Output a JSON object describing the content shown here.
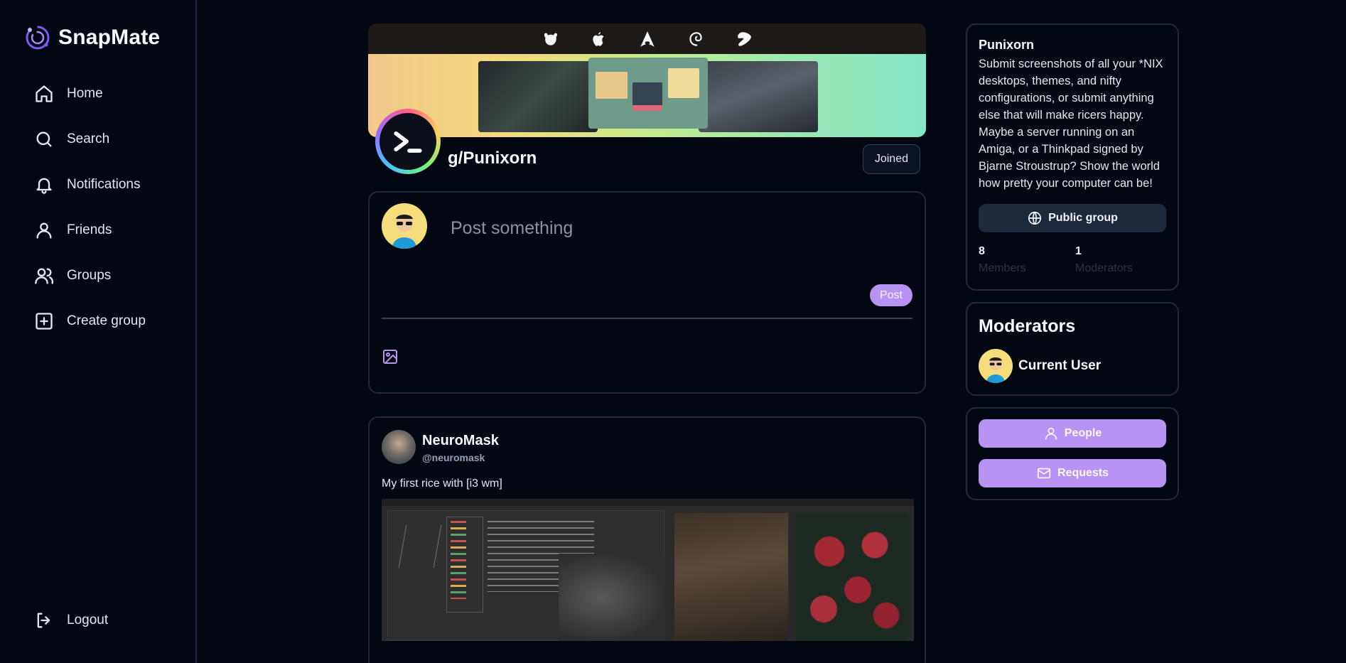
{
  "brand": {
    "name": "SnapMate",
    "accent": "#9b6bff"
  },
  "nav": {
    "items": [
      {
        "label": "Home",
        "icon": "home-icon"
      },
      {
        "label": "Search",
        "icon": "search-icon"
      },
      {
        "label": "Notifications",
        "icon": "bell-icon"
      },
      {
        "label": "Friends",
        "icon": "user-icon"
      },
      {
        "label": "Groups",
        "icon": "users-icon"
      },
      {
        "label": "Create group",
        "icon": "plus-square-icon"
      }
    ],
    "logout": {
      "label": "Logout",
      "icon": "logout-icon"
    }
  },
  "group": {
    "title": "g/Punixorn",
    "joined_label": "Joined",
    "os_icons": [
      "freebsd-icon",
      "apple-icon",
      "arch-icon",
      "debian-icon",
      "gentoo-icon"
    ]
  },
  "composer": {
    "placeholder": "Post something",
    "post_label": "Post"
  },
  "post": {
    "author": "NeuroMask",
    "handle": "@neuromask",
    "text": "My first rice with [i3 wm]"
  },
  "about": {
    "name": "Punixorn",
    "description": "Submit screenshots of all your *NIX desktops, themes, and nifty configurations, or submit anything else that will make ricers happy. Maybe a server running on an Amiga, or a Thinkpad signed by Bjarne Stroustrup? Show the world how pretty your computer can be!",
    "visibility_label": "Public group",
    "members_count": "8",
    "members_label": "Members",
    "moderators_count": "1",
    "moderators_label": "Moderators"
  },
  "moderators": {
    "title": "Moderators",
    "list": [
      {
        "name": "Current User"
      }
    ]
  },
  "actions": {
    "people_label": "People",
    "requests_label": "Requests"
  },
  "colors": {
    "background": "#030711",
    "border": "#1e293b",
    "accent_purple": "#b794f4"
  }
}
